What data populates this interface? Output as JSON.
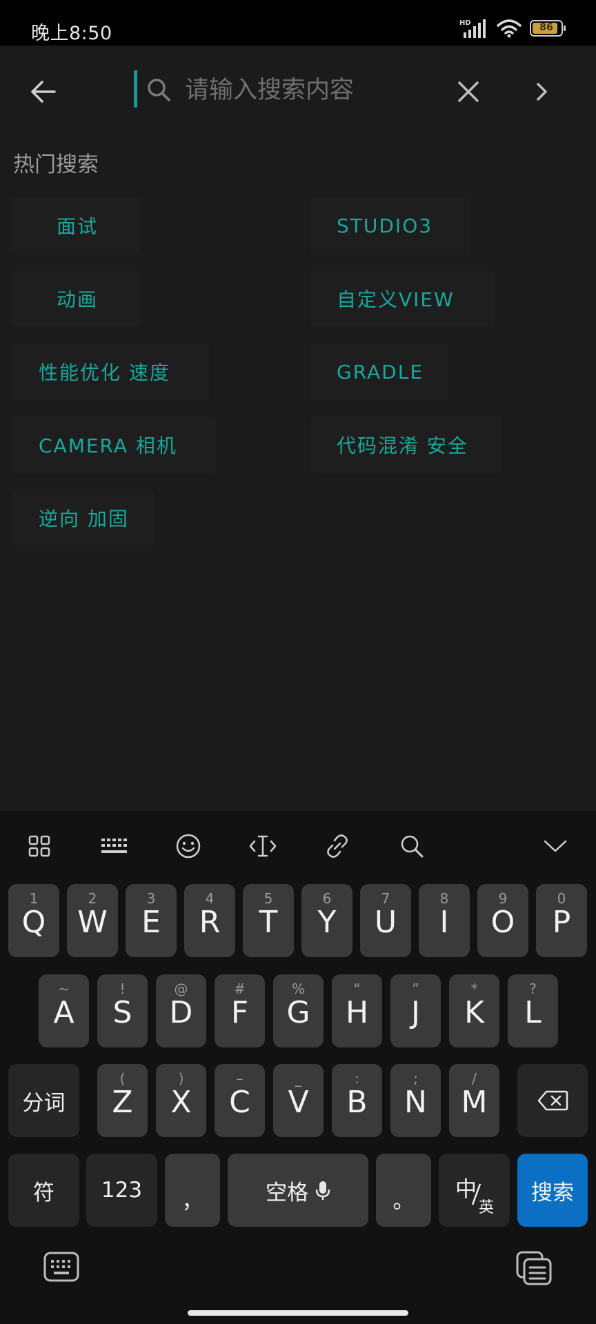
{
  "status_bar": {
    "time": "晚上8:50",
    "network": "HD",
    "battery": "86"
  },
  "search": {
    "placeholder": "请输入搜索内容",
    "value": ""
  },
  "hot_search": {
    "title": "热门搜索",
    "tags": [
      "面试",
      "STUDIO3",
      "动画",
      "自定义VIEW",
      "性能优化 速度",
      "GRADLE",
      "CAMERA 相机",
      "代码混淆 安全",
      "逆向 加固"
    ]
  },
  "keyboard": {
    "row1": [
      {
        "main": "Q",
        "sub": "1"
      },
      {
        "main": "W",
        "sub": "2"
      },
      {
        "main": "E",
        "sub": "3"
      },
      {
        "main": "R",
        "sub": "4"
      },
      {
        "main": "T",
        "sub": "5"
      },
      {
        "main": "Y",
        "sub": "6"
      },
      {
        "main": "U",
        "sub": "7"
      },
      {
        "main": "I",
        "sub": "8"
      },
      {
        "main": "O",
        "sub": "9"
      },
      {
        "main": "P",
        "sub": "0"
      }
    ],
    "row2": [
      {
        "main": "A",
        "sub": "~"
      },
      {
        "main": "S",
        "sub": "!"
      },
      {
        "main": "D",
        "sub": "@"
      },
      {
        "main": "F",
        "sub": "#"
      },
      {
        "main": "G",
        "sub": "%"
      },
      {
        "main": "H",
        "sub": "“"
      },
      {
        "main": "J",
        "sub": "”"
      },
      {
        "main": "K",
        "sub": "*"
      },
      {
        "main": "L",
        "sub": "?"
      }
    ],
    "row3": [
      {
        "main": "Z",
        "sub": "("
      },
      {
        "main": "X",
        "sub": ")"
      },
      {
        "main": "C",
        "sub": "–"
      },
      {
        "main": "V",
        "sub": "_"
      },
      {
        "main": "B",
        "sub": ":"
      },
      {
        "main": "N",
        "sub": ";"
      },
      {
        "main": "M",
        "sub": "/"
      }
    ],
    "fenci": "分词",
    "fu": "符",
    "num": "123",
    "comma": "，",
    "space": "空格",
    "period": "。",
    "lang_main": "中",
    "lang_sub": "英",
    "search": "搜索"
  },
  "colors": {
    "accent": "#169c92",
    "tag_text": "#18a89c",
    "search_key": "#0b6fc4"
  }
}
